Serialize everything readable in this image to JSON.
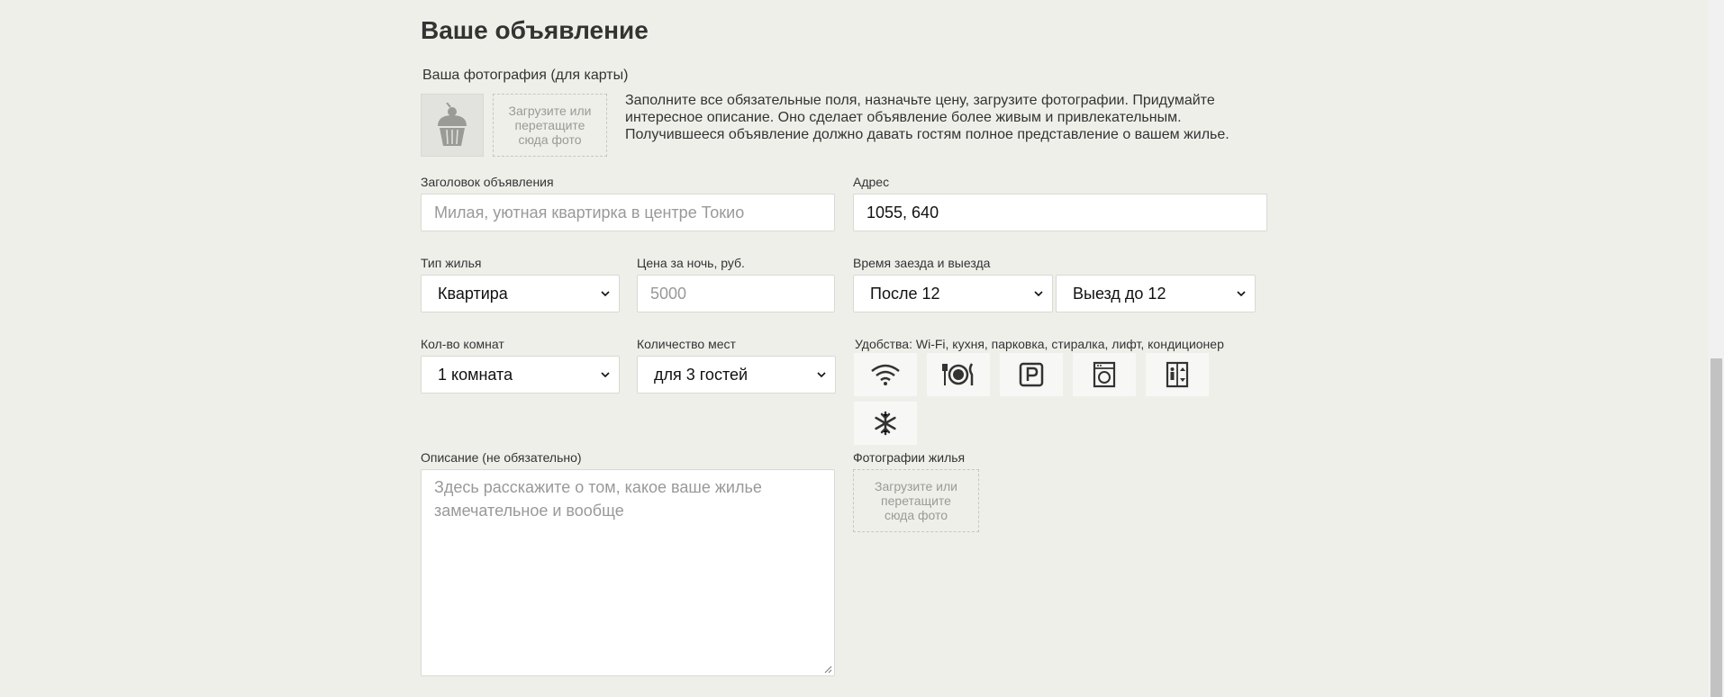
{
  "page": {
    "title": "Ваше объявление",
    "avatar_label": "Ваша фотография (для карты)",
    "avatar_drop_text": "Загрузите или перетащите сюда фото",
    "hint_text": "Заполните все обязательные поля, назначьте цену, загрузите фотографии. Придумайте интересное описание. Оно сделает объявление более живым и привлекательным. Получившееся объявление должно давать гостям полное представление о вашем жилье."
  },
  "form": {
    "title_label": "Заголовок объявления",
    "title_placeholder": "Милая, уютная квартирка в центре Токио",
    "address_label": "Адрес",
    "address_value": "1055, 640",
    "type_label": "Тип жилья",
    "type_value": "Квартира",
    "price_label": "Цена за ночь, руб.",
    "price_placeholder": "5000",
    "time_label": "Время заезда и выезда",
    "checkin_value": "После 12",
    "checkout_value": "Выезд до 12",
    "rooms_label": "Кол-во комнат",
    "rooms_value": "1 комната",
    "capacity_label": "Количество мест",
    "capacity_value": "для 3 гостей",
    "features_label": "Удобства: Wi-Fi, кухня, парковка, стиралка, лифт, кондиционер",
    "features": [
      {
        "name": "wifi-icon"
      },
      {
        "name": "dishwasher-icon"
      },
      {
        "name": "parking-icon"
      },
      {
        "name": "washer-icon"
      },
      {
        "name": "elevator-icon"
      },
      {
        "name": "conditioner-icon"
      }
    ],
    "description_label": "Описание (не обязательно)",
    "description_placeholder": "Здесь расскажите о том, какое ваше жилье замечательное и вообще",
    "photos_label": "Фотографии жилья",
    "photos_drop_text": "Загрузите или перетащите сюда фото"
  },
  "colors": {
    "background": "#efefea",
    "field_border": "#d9d9d4",
    "placeholder": "#999999"
  }
}
